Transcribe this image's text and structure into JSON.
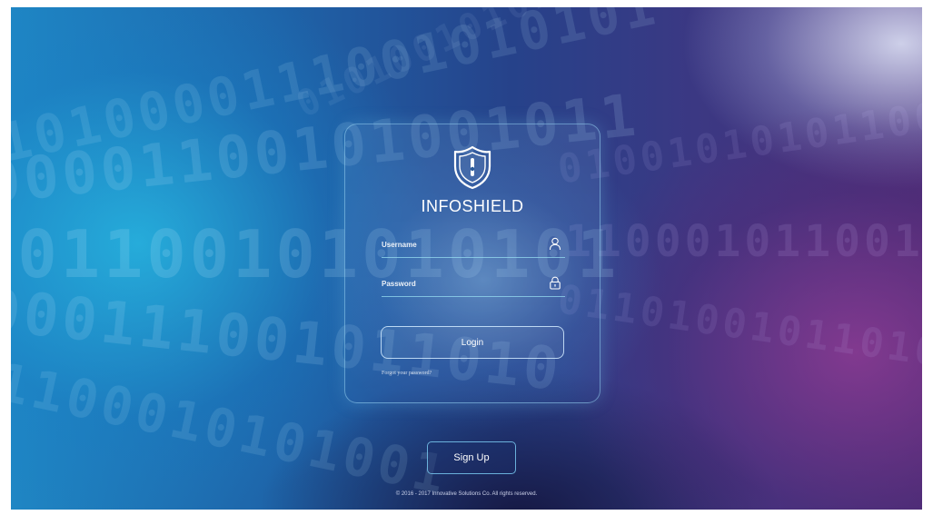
{
  "brand": {
    "name": "INFOSHIELD",
    "logo_icon": "shield-icon"
  },
  "login_form": {
    "username_placeholder": "Username",
    "username_value": "",
    "username_icon": "user-icon",
    "password_placeholder": "Password",
    "password_value": "",
    "password_icon": "lock-icon",
    "login_label": "Login",
    "forgot_label": "Forgot your password?"
  },
  "signup": {
    "label": "Sign Up"
  },
  "footer": {
    "copyright": "© 2016 - 2017 Innovative Solutions Co. All rights reserved."
  },
  "colors": {
    "accent_border": "#96d2f0",
    "text": "#ffffff",
    "bg_left": "#1f86c4",
    "bg_right": "#4a2f78"
  }
}
